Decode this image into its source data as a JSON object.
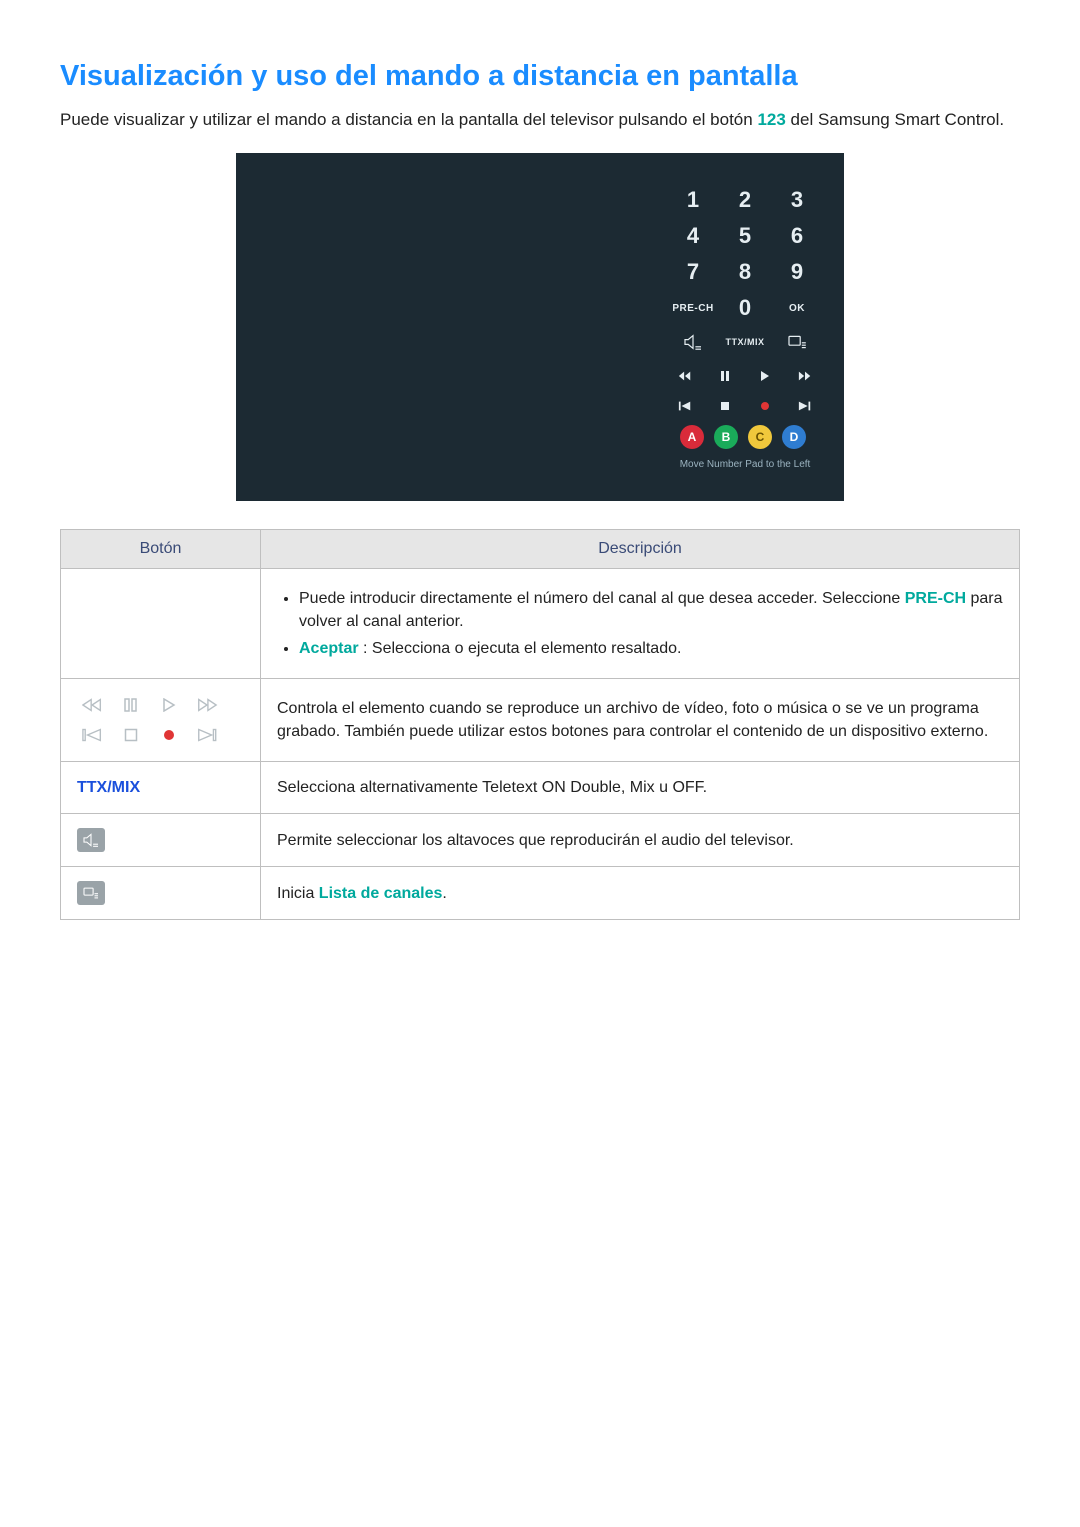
{
  "title": "Visualización y uso del mando a distancia en pantalla",
  "intro": {
    "pre": "Puede visualizar y utilizar el mando a distancia en la pantalla del televisor pulsando el botón ",
    "kw": "123",
    "post": " del Samsung Smart Control."
  },
  "remote": {
    "numbers": [
      "1",
      "2",
      "3",
      "4",
      "5",
      "6",
      "7",
      "8",
      "9"
    ],
    "prech": "PRE-CH",
    "zero": "0",
    "ok": "OK",
    "ttxmix": "TTX/MIX",
    "colors": {
      "a": "A",
      "b": "B",
      "c": "C",
      "d": "D"
    },
    "hint": "Move Number Pad to the Left"
  },
  "table": {
    "headers": {
      "boton": "Botón",
      "desc": "Descripción"
    },
    "rows": {
      "numpad": {
        "li1_pre": "Puede introducir directamente el número del canal al que desea acceder. Seleccione ",
        "li1_kw": "PRE-CH",
        "li1_post": " para volver al canal anterior.",
        "li2_kw": "Aceptar",
        "li2_post": " : Selecciona o ejecuta el elemento resaltado."
      },
      "playback": {
        "desc": "Controla el elemento cuando se reproduce un archivo de vídeo, foto o música o se ve un programa grabado. También puede utilizar estos botones para controlar el contenido de un dispositivo externo."
      },
      "ttxmix": {
        "label": "TTX/MIX",
        "desc": "Selecciona alternativamente Teletext ON Double, Mix u OFF."
      },
      "speakers": {
        "desc": "Permite seleccionar los altavoces que reproducirán el audio del televisor."
      },
      "chlist": {
        "desc_pre": "Inicia ",
        "desc_kw": "Lista de canales",
        "desc_post": "."
      }
    }
  }
}
